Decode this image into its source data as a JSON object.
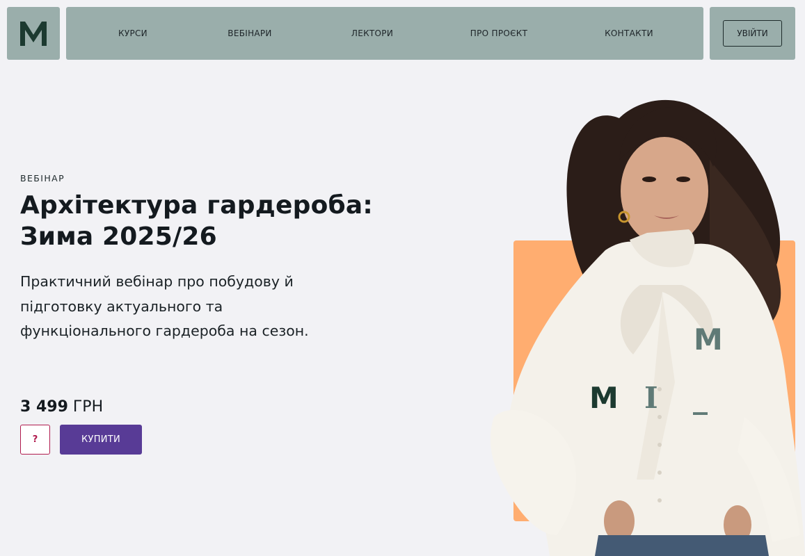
{
  "header": {
    "logo_letter": "M",
    "nav": [
      {
        "label": "КУРСИ"
      },
      {
        "label": "ВЕБІНАРИ"
      },
      {
        "label": "ЛЕКТОРИ"
      },
      {
        "label": "ПРО ПРОЄКТ"
      },
      {
        "label": "КОНТАКТИ"
      }
    ],
    "login_label": "УВІЙТИ"
  },
  "hero": {
    "eyebrow": "ВЕБІНАР",
    "title_line1": "Архітектура гардероба:",
    "title_line2": "Зима 2025/26",
    "description": "Практичний вебінар про побудову й підготовку актуального та функціонального гардероба на сезон.",
    "price_amount": "3 499",
    "price_currency": "ГРН",
    "help_label": "?",
    "buy_label": "КУПИТИ",
    "overlay_letters": [
      "M",
      "M",
      "I",
      "_"
    ]
  },
  "colors": {
    "header_bg": "#9aaeab",
    "page_bg": "#f2f2f5",
    "accent_orange": "#ffad70",
    "buy_button": "#583b96",
    "help_border": "#b01a4d",
    "logo_dark": "#1c3a30",
    "logo_muted": "#5f7a76"
  }
}
